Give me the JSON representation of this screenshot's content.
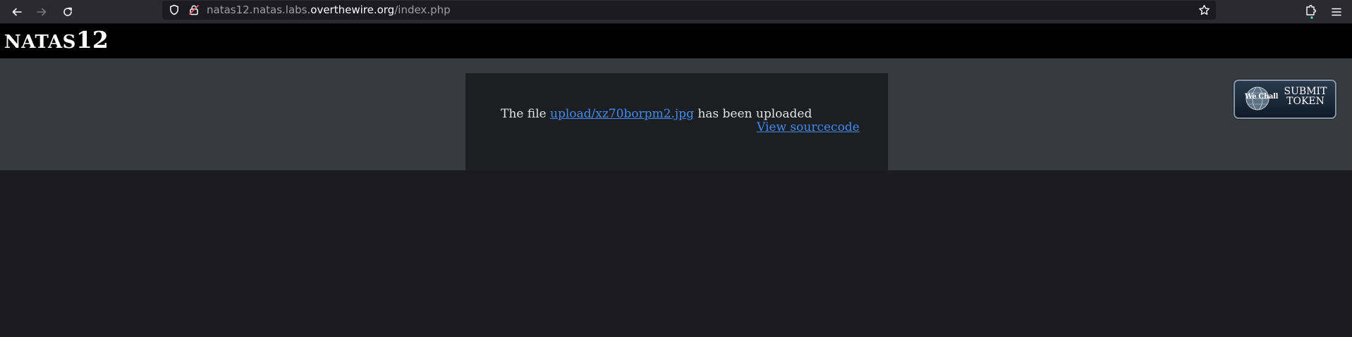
{
  "browser": {
    "url_prefix": "natas12.natas.labs.",
    "url_host": "overthewire.org",
    "url_path": "/index.php"
  },
  "header": {
    "logo_prefix": "NATAS",
    "logo_number": "12"
  },
  "content": {
    "message_prefix": "The file ",
    "uploaded_file": "upload/xz70borpm2.jpg",
    "message_suffix": " has been uploaded",
    "view_source_label": "View sourcecode"
  },
  "token_badge": {
    "wechall_label": "We Chall",
    "submit_label": "SUBMIT",
    "token_label": "TOKEN"
  },
  "icons": {
    "back": "back-arrow-icon",
    "forward": "forward-arrow-icon",
    "reload": "reload-icon",
    "shield": "shield-icon",
    "lock": "lock-icon",
    "bookmark": "star-icon",
    "extensions": "puzzle-icon",
    "menu": "hamburger-menu-icon"
  },
  "colors": {
    "link": "#3e8df3",
    "band": "#373a3e",
    "content_bg": "#1d1e21",
    "page_bg": "#1c1b22"
  }
}
